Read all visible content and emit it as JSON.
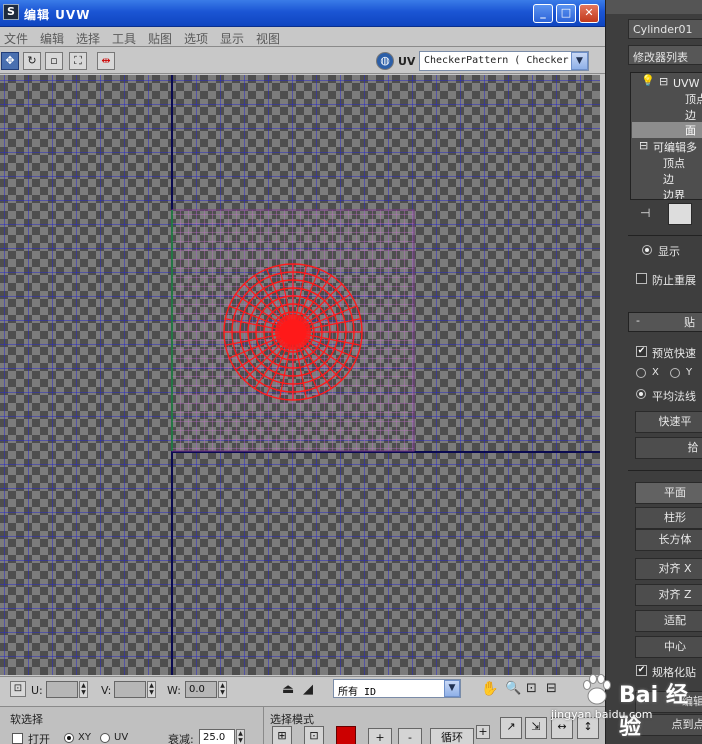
{
  "window": {
    "title": "编辑 UVW",
    "app_icon": "3ds-max-icon",
    "controls": {
      "minimize": "_",
      "maximize": "□",
      "close": "✕"
    }
  },
  "menu": [
    "文件",
    "编辑",
    "选择",
    "工具",
    "贴图",
    "选项",
    "显示",
    "视图"
  ],
  "toolbar": {
    "icons": [
      "move-icon",
      "rotate-icon",
      "scale-icon",
      "freeform-icon",
      "mirror-icon",
      "globe-icon"
    ],
    "uv_label": "UV",
    "map_select": "CheckerPattern  ( Checker"
  },
  "canvas": {
    "background": "#444444",
    "checker_light": "#7c7c7c",
    "checker_dark": "#4e4e4e",
    "grid_color": "#2a2ac8",
    "uv_mesh_color": "#c070c8",
    "selection_color": "#ff1a1a"
  },
  "statusbar": {
    "u_label": "U:",
    "v_label": "V:",
    "w_label": "W:",
    "u_value": "",
    "v_value": "",
    "w_value": "0.0",
    "filter_select": "所有 ID",
    "icons": [
      "lock-icon",
      "pick-icon",
      "pan-hand-icon",
      "zoom-icon",
      "zoom-region-icon",
      "zoom-extents-icon"
    ]
  },
  "bottom_panel": {
    "soft_selection_title": "软选择",
    "soft_open_label": "打开",
    "xy_label": "XY",
    "uv_label": "UV",
    "falloff_label": "衰减:",
    "falloff_value": "25.0",
    "selection_mode_title": "选择模式",
    "plus_label": "+",
    "minus_label": "-",
    "loop_label": "循环"
  },
  "right_panel": {
    "object_name": "Cylinder01",
    "modifier_list": "修改器列表",
    "stack": [
      {
        "label": "UVW 展",
        "level": 0
      },
      {
        "label": "顶点",
        "level": 2
      },
      {
        "label": "边",
        "level": 2
      },
      {
        "label": "面",
        "level": 2,
        "selected": true
      },
      {
        "label": "可编辑多",
        "level": 0
      },
      {
        "label": "顶点",
        "level": 1
      },
      {
        "label": "边",
        "level": 1
      },
      {
        "label": "边界",
        "level": 1
      }
    ],
    "show_end_result": "显示",
    "prevent_relax": "防止重展",
    "rollout_title": "贴",
    "preview_quick": "预览快速",
    "axis_x": "X",
    "axis_y": "Y",
    "average_normals": "平均法线",
    "quick_planar": "快速平",
    "pick_button": "拾",
    "planar": "平面",
    "cylindrical": "柱形",
    "box": "长方体",
    "align_x": "对齐 X",
    "align_z": "对齐 Z",
    "fit": "适配",
    "center": "中心",
    "normalize_map": "规格化贴",
    "edit_button": "编辑",
    "to_point": "点到点"
  },
  "watermark": {
    "text": "Bai 经验",
    "url": "jingyan.baidu.com"
  }
}
